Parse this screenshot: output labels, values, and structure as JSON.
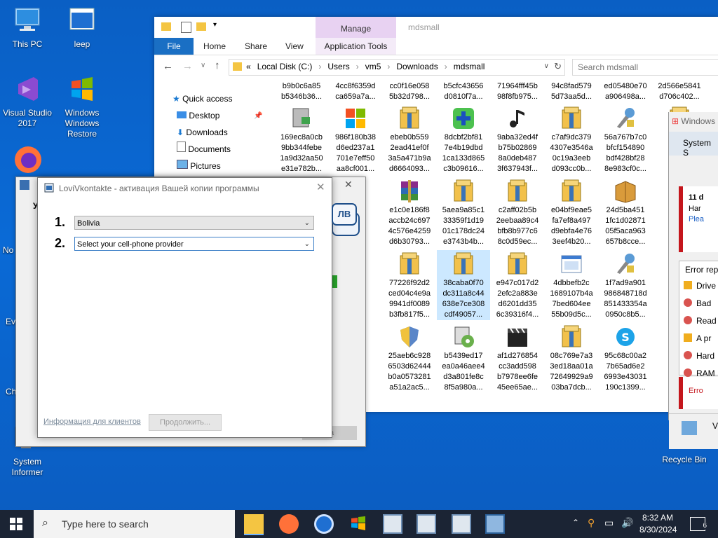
{
  "desktop": {
    "icons": [
      {
        "label": "This PC"
      },
      {
        "label": "leep"
      },
      {
        "label": "Visual Studio 2017"
      },
      {
        "label": "Windows Windows Restore"
      },
      {
        "label": "System Informer"
      },
      {
        "label": "Recycle Bin"
      }
    ],
    "partial_labels": [
      "No",
      "Ev",
      "Ch"
    ]
  },
  "explorer": {
    "title": "mdsmall",
    "manage_tab": "Manage",
    "tabs": [
      "File",
      "Home",
      "Share",
      "View",
      "Application Tools"
    ],
    "breadcrumb": [
      "«",
      "Local Disk (C:)",
      "Users",
      "vm5",
      "Downloads",
      "mdsmall"
    ],
    "search_placeholder": "Search mdsmall",
    "nav": [
      "Quick access",
      "Desktop",
      "Downloads",
      "Documents",
      "Pictures"
    ],
    "files_row0": [
      [
        "b9b0c6a85",
        "b5346b36..."
      ],
      [
        "4cc8f6359d",
        "ca659a7a..."
      ],
      [
        "cc0f16e058",
        "5b32d798..."
      ],
      [
        "b5cfc43656",
        "d0810f7a..."
      ],
      [
        "71964fff45b",
        "98f8fb975..."
      ],
      [
        "94c8fad579",
        "5d73aa5d..."
      ],
      [
        "ed05480e70",
        "a906498a..."
      ],
      [
        "2d566e5841",
        "d706c402..."
      ],
      [
        "01",
        "a6"
      ]
    ],
    "files": [
      {
        "lines": [
          "169ec8a0cb",
          "9bb344febe",
          "1a9d32aa50",
          "e31e782b..."
        ],
        "icon": "installer-icon"
      },
      {
        "lines": [
          "986f180b38",
          "d6ed237a1",
          "701e7eff50",
          "aa8cf001..."
        ],
        "icon": "windows-logo-icon"
      },
      {
        "lines": [
          "ebeb0b559",
          "2ead41ef0f",
          "3a5a471b9a",
          "d6664093..."
        ],
        "icon": "zip-archive-icon"
      },
      {
        "lines": [
          "8dcbf2bf81",
          "7e4b19dbd",
          "1ca133d865",
          "c3b09616..."
        ],
        "icon": "green-plus-icon"
      },
      {
        "lines": [
          "9aba32ed4f",
          "b75b02869",
          "8a0deb487",
          "3f637943f..."
        ],
        "icon": "music-note-icon"
      },
      {
        "lines": [
          "c7af9dc379",
          "4307e3546a",
          "0c19a3eeb",
          "d093cc0b..."
        ],
        "icon": "zip-archive-icon"
      },
      {
        "lines": [
          "56a767b7c0",
          "bfcf154890",
          "bdf428bf28",
          "8e983cf0c..."
        ],
        "icon": "tools-icon"
      },
      {
        "lines": [
          "259",
          "2be",
          "0d6",
          "cdf"
        ],
        "icon": "zip-archive-icon"
      },
      {
        "lines": [
          "e1c0e186f8",
          "accb24c697",
          "4c576e4259",
          "d6b30793..."
        ],
        "icon": "winrar-icon"
      },
      {
        "lines": [
          "5aea9a85c1",
          "33359f1d19",
          "01c178dc24",
          "e3743b4b..."
        ],
        "icon": "zip-archive-icon"
      },
      {
        "lines": [
          "c2aff02b5b",
          "2eebaa89c4",
          "bfb8b977c6",
          "8c0d59ec..."
        ],
        "icon": "zip-archive-icon"
      },
      {
        "lines": [
          "e04bf9eae5",
          "fa7ef8a497",
          "d9ebfa4e76",
          "3eef4b20..."
        ],
        "icon": "zip-archive-icon"
      },
      {
        "lines": [
          "24d5ba451",
          "1fc1d02871",
          "05f5aca963",
          "657b8cce..."
        ],
        "icon": "package-box-icon"
      },
      {
        "lines": [
          "a7c",
          "091",
          "267",
          "f36"
        ],
        "icon": "zip-archive-icon"
      },
      {
        "lines": [
          "77226f92d2",
          "ced04c4e9a",
          "9941df0089",
          "b3fb817f5..."
        ],
        "icon": "zip-archive-icon"
      },
      {
        "lines": [
          "38caba0f70",
          "dc311a8c44",
          "638e7ce308",
          "cdf49057..."
        ],
        "icon": "zip-archive-icon"
      },
      {
        "lines": [
          "e947c017d2",
          "2efc2a883e",
          "d6201dd35",
          "6c39316f4..."
        ],
        "icon": "zip-archive-icon"
      },
      {
        "lines": [
          "4dbbefb2c",
          "1689107b4a",
          "7bed604ee",
          "55b09d5c..."
        ],
        "icon": "window-app-icon"
      },
      {
        "lines": [
          "1f7ad9a901",
          "986848718d",
          "851433354a",
          "0950c8b5..."
        ],
        "icon": "tools-icon"
      },
      {
        "lines": [
          "95b",
          "6a7",
          "b77",
          "4aa"
        ],
        "icon": "zip-archive-icon"
      },
      {
        "lines": [
          "25aeb6c928",
          "6503d62444",
          "b0a0573281",
          "a51a2ac5..."
        ],
        "icon": "shield-icon"
      },
      {
        "lines": [
          "b5439ed17",
          "ea0a46aee4",
          "d3a801fe8c",
          "8f5a980a..."
        ],
        "icon": "disc-setup-icon"
      },
      {
        "lines": [
          "af1d276854",
          "cc3add598",
          "b7978ee6fe",
          "45ee65ae..."
        ],
        "icon": "clapperboard-icon"
      },
      {
        "lines": [
          "08c769e7a3",
          "3ed18aa01a",
          "72649929a9",
          "03ba7dcb..."
        ],
        "icon": "zip-archive-icon"
      },
      {
        "lines": [
          "95c68c00a2",
          "7b65ad6e2",
          "6993e43031",
          "190c1399..."
        ],
        "icon": "skype-icon"
      },
      {
        "lines": [
          "259",
          "040",
          "a46",
          "c90"
        ],
        "icon": "zip-archive-icon"
      }
    ],
    "left_partial_files": [
      [
        "7d",
        "8fa",
        "13e",
        "7..."
      ],
      [
        "d20",
        "35",
        "83a",
        "7..."
      ],
      [
        "0c9",
        "b48",
        "116",
        "d..."
      ]
    ]
  },
  "behind_window": {
    "title_partial": "У",
    "close": "✕",
    "button_partial": "на"
  },
  "sysinfo_window": {
    "title": "Windows",
    "menu": "System S",
    "alert_lines": [
      "11 d",
      "Har",
      "Plea"
    ],
    "error_header": "Error rep",
    "errors": [
      {
        "icon": "warning-icon",
        "text": "Drive"
      },
      {
        "icon": "error-icon",
        "text": "Bad"
      },
      {
        "icon": "error-icon",
        "text": "Read"
      },
      {
        "icon": "warning-icon",
        "text": "A pr"
      },
      {
        "icon": "error-icon",
        "text": "Hard"
      },
      {
        "icon": "error-icon",
        "text": "RAM"
      }
    ],
    "error_footer": "Erro",
    "bottom_text": "V"
  },
  "dialog": {
    "title": "LoviVkontakte - активация Вашей копии программы",
    "logo_text": "ЛВ",
    "step1_num": "1.",
    "step1_value": "Bolivia",
    "step2_num": "2.",
    "step2_value": "Select your cell-phone provider",
    "info_link": "Информация для клиентов",
    "continue_button": "Продолжить..."
  },
  "taskbar": {
    "search_placeholder": "Type here to search",
    "time": "8:32 AM",
    "date": "8/30/2024",
    "notification_count": "6"
  },
  "colors": {
    "accent": "#0078d7",
    "manage_tab": "#e8d2f2",
    "taskbar": "#1b2434"
  }
}
